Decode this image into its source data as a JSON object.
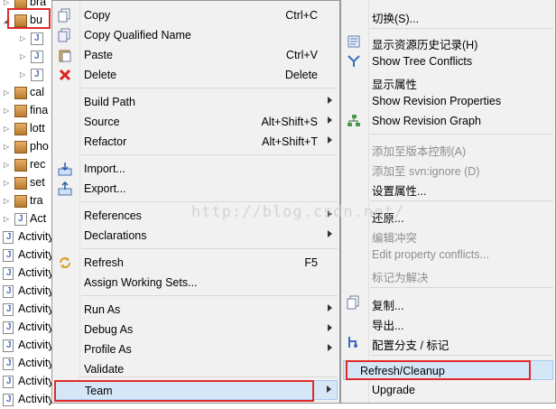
{
  "tree": {
    "items": [
      {
        "label": "bra",
        "kind": "pkg",
        "indent": 1
      },
      {
        "label": "bu",
        "kind": "pkg",
        "indent": 0,
        "expanded": true,
        "selected": true
      },
      {
        "label": "",
        "kind": "java",
        "indent": 2
      },
      {
        "label": "",
        "kind": "java",
        "indent": 2
      },
      {
        "label": "",
        "kind": "java",
        "indent": 2
      },
      {
        "label": "cal",
        "kind": "pkg",
        "indent": 1
      },
      {
        "label": "fina",
        "kind": "pkg",
        "indent": 1
      },
      {
        "label": "lott",
        "kind": "pkg",
        "indent": 1
      },
      {
        "label": "pho",
        "kind": "pkg",
        "indent": 1
      },
      {
        "label": "rec",
        "kind": "pkg",
        "indent": 1
      },
      {
        "label": "set",
        "kind": "pkg",
        "indent": 1
      },
      {
        "label": "tra",
        "kind": "pkg",
        "indent": 1
      },
      {
        "label": "Act",
        "kind": "java",
        "indent": 1
      },
      {
        "label": "Activity",
        "kind": "file",
        "indent": 0
      },
      {
        "label": "Activity",
        "kind": "file",
        "indent": 0
      },
      {
        "label": "Activity",
        "kind": "file",
        "indent": 0
      },
      {
        "label": "Activity",
        "kind": "file",
        "indent": 0
      },
      {
        "label": "Activity",
        "kind": "file",
        "indent": 0
      },
      {
        "label": "Activity",
        "kind": "file",
        "indent": 0
      },
      {
        "label": "Activity",
        "kind": "file",
        "indent": 0
      },
      {
        "label": "Activity",
        "kind": "file",
        "indent": 0
      },
      {
        "label": "Activity",
        "kind": "file",
        "indent": 0
      },
      {
        "label": "Activity",
        "kind": "file",
        "indent": 0
      }
    ]
  },
  "main_menu": {
    "copy": {
      "label": "Copy",
      "shortcut": "Ctrl+C",
      "icon": "copy-icon"
    },
    "copy_qualified": {
      "label": "Copy Qualified Name"
    },
    "paste": {
      "label": "Paste",
      "shortcut": "Ctrl+V",
      "icon": "paste-icon"
    },
    "delete": {
      "label": "Delete",
      "shortcut": "Delete",
      "icon": "delete-icon"
    },
    "build_path": {
      "label": "Build Path"
    },
    "source": {
      "label": "Source",
      "shortcut": "Alt+Shift+S"
    },
    "refactor": {
      "label": "Refactor",
      "shortcut": "Alt+Shift+T"
    },
    "import": {
      "label": "Import...",
      "icon": "import-icon"
    },
    "export": {
      "label": "Export...",
      "icon": "export-icon"
    },
    "references": {
      "label": "References"
    },
    "declarations": {
      "label": "Declarations"
    },
    "refresh": {
      "label": "Refresh",
      "shortcut": "F5",
      "icon": "refresh-icon"
    },
    "assign_working_sets": {
      "label": "Assign Working Sets..."
    },
    "run_as": {
      "label": "Run As"
    },
    "debug_as": {
      "label": "Debug As"
    },
    "profile_as": {
      "label": "Profile As"
    },
    "validate": {
      "label": "Validate"
    },
    "team": {
      "label": "Team"
    }
  },
  "team_menu": {
    "switch": {
      "label": "切换(S)..."
    },
    "history": {
      "label": "显示资源历史记录(H)",
      "icon": "history-icon"
    },
    "tree_conflicts": {
      "label": "Show Tree Conflicts",
      "icon": "tree-conflicts-icon"
    },
    "properties": {
      "label": "显示属性"
    },
    "revision_properties": {
      "label": "Show Revision Properties"
    },
    "revision_graph": {
      "label": "Show Revision Graph",
      "icon": "graph-icon"
    },
    "add_vc": {
      "label": "添加至版本控制(A)",
      "disabled": true
    },
    "add_ignore": {
      "label": "添加至 svn:ignore (D)",
      "disabled": true
    },
    "set_property": {
      "label": "设置属性..."
    },
    "revert": {
      "label": "还原..."
    },
    "edit_conflicts": {
      "label": "编辑冲突",
      "disabled": true
    },
    "edit_property_conflicts": {
      "label": "Edit property conflicts...",
      "disabled": true
    },
    "mark_resolved": {
      "label": "标记为解决",
      "disabled": true
    },
    "copy": {
      "label": "复制...",
      "icon": "copy-icon"
    },
    "export": {
      "label": "导出..."
    },
    "branch_tag": {
      "label": "配置分支 / 标记",
      "icon": "branch-tag-icon"
    },
    "refresh_cleanup": {
      "label": "Refresh/Cleanup"
    },
    "upgrade": {
      "label": "Upgrade"
    }
  },
  "watermark": "http://blog.csdn.net/",
  "colors": {
    "highlight_box": "#e02a2a",
    "menu_bg": "#f1f1f1",
    "hover": "#d5e6f7"
  }
}
